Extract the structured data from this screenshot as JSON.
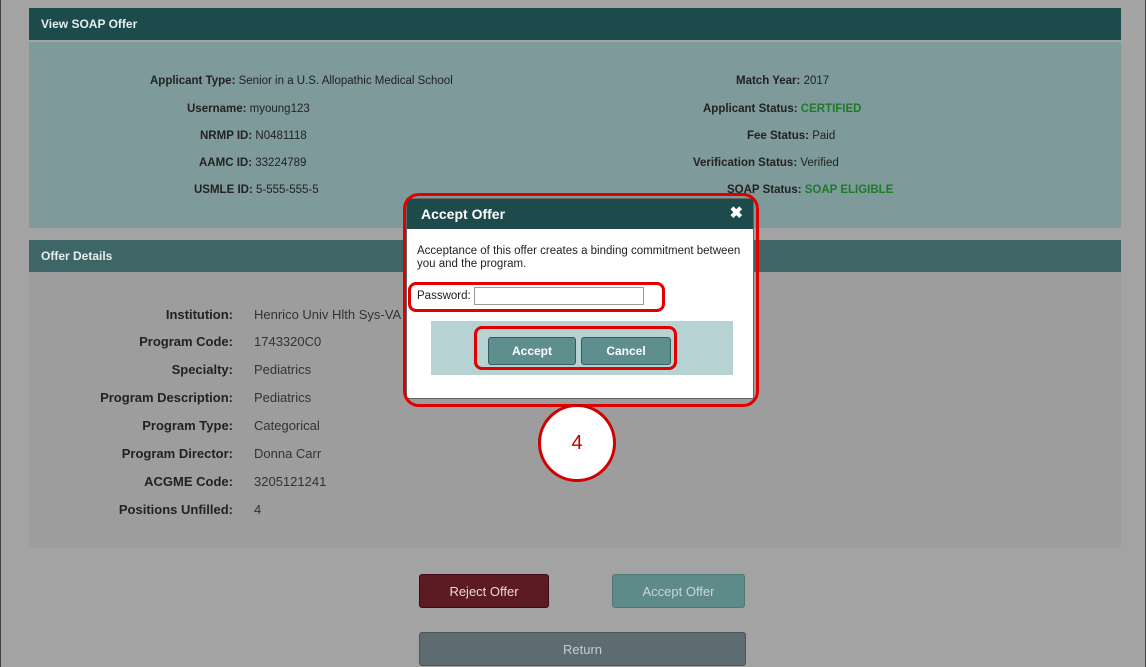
{
  "soap_panel": {
    "title": "View SOAP Offer",
    "left_fields": [
      {
        "label": "Applicant Type:",
        "value": "Senior in a U.S. Allopathic Medical School"
      },
      {
        "label": "Username:",
        "value": "myoung123"
      },
      {
        "label": "NRMP ID:",
        "value": "N0481118"
      },
      {
        "label": "AAMC ID:",
        "value": "33224789"
      },
      {
        "label": "USMLE ID:",
        "value": "5-555-555-5"
      }
    ],
    "right_fields": [
      {
        "label": "Match Year:",
        "value": "2017"
      },
      {
        "label": "Applicant Status:",
        "value": "CERTIFIED"
      },
      {
        "label": "Fee Status:",
        "value": "Paid"
      },
      {
        "label": "Verification Status:",
        "value": "Verified"
      },
      {
        "label": "SOAP Status:",
        "value": "SOAP ELIGIBLE"
      }
    ]
  },
  "offer_panel": {
    "title": "Offer Details",
    "fields": [
      {
        "label": "Institution:",
        "value": "Henrico Univ Hlth Sys-VA"
      },
      {
        "label": "Program Code:",
        "value": "1743320C0"
      },
      {
        "label": "Specialty:",
        "value": "Pediatrics"
      },
      {
        "label": "Program Description:",
        "value": "Pediatrics"
      },
      {
        "label": "Program Type:",
        "value": "Categorical"
      },
      {
        "label": "Program Director:",
        "value": "Donna Carr"
      },
      {
        "label": "ACGME Code:",
        "value": "3205121241"
      },
      {
        "label": "Positions Unfilled:",
        "value": "4"
      }
    ]
  },
  "actions": {
    "reject_label": "Reject Offer",
    "accept_label": "Accept Offer",
    "return_label": "Return"
  },
  "modal": {
    "title": "Accept Offer",
    "close_glyph": "✖",
    "message": "Acceptance of this offer creates a binding commitment between you and the program.",
    "password_label": "Password:",
    "password_value": "",
    "accept_label": "Accept",
    "cancel_label": "Cancel"
  },
  "annotation": {
    "step_number": "4",
    "highlight_color": "#e00000"
  },
  "colors": {
    "header_teal": "#1d4a4a",
    "status_green": "#1f7a2a",
    "reject_maroon": "#5c1a22"
  }
}
